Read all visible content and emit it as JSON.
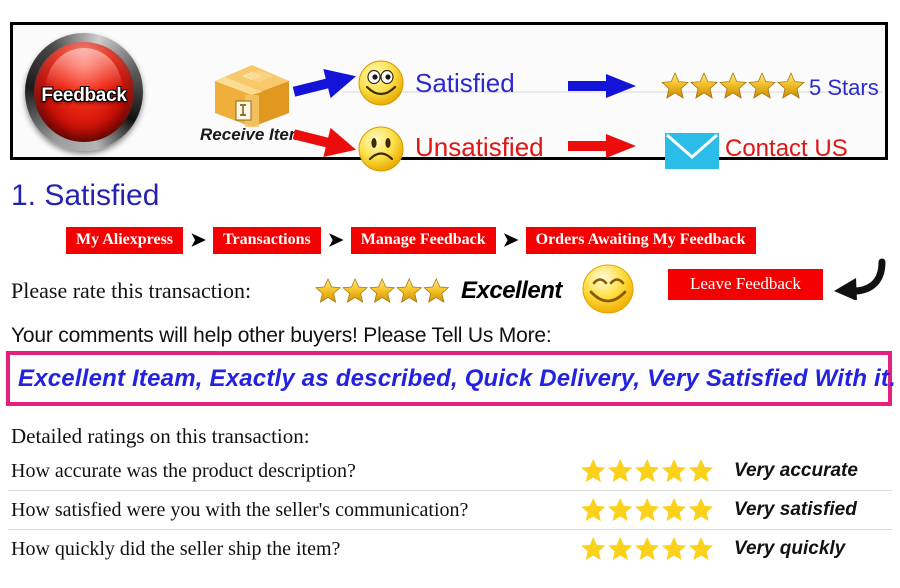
{
  "banner": {
    "feedback_button_label": "Feedback",
    "receive_item_label": "Receive Item",
    "satisfied_label": "Satisfied",
    "unsatisfied_label": "Unsatisfied",
    "five_stars_label": "5 Stars",
    "contact_us_label": "Contact US",
    "colors": {
      "satisfied_text": "#2a2ad0",
      "unsatisfied_text": "#e01515",
      "button_red": "#f22d18",
      "envelope_blue": "#29bde8",
      "star_gold": "#f0b21c"
    }
  },
  "section": {
    "title": "1. Satisfied",
    "title_color": "#2424ad"
  },
  "breadcrumb": {
    "separator": "➤",
    "items": [
      {
        "label": "My Aliexpress"
      },
      {
        "label": "Transactions"
      },
      {
        "label": "Manage Feedback"
      },
      {
        "label": "Orders Awaiting My Feedback"
      }
    ]
  },
  "rate_row": {
    "label": "Please rate this transaction:",
    "stars": 5,
    "rating_word": "Excellent",
    "leave_feedback_label": "Leave Feedback"
  },
  "comments": {
    "prompt": "Your comments will help other buyers! Please Tell Us More:",
    "review_text": "Excellent Iteam, Exactly as described, Quick Delivery, Very Satisfied With it.",
    "box_border_color": "#e5207f",
    "review_text_color": "#2222e0"
  },
  "detailed_ratings": {
    "title": "Detailed ratings on this transaction:",
    "star_color": "#fbd11a",
    "rows": [
      {
        "question": "How accurate was the product description?",
        "stars": 5,
        "answer": "Very accurate"
      },
      {
        "question": "How satisfied were you with the seller's communication?",
        "stars": 5,
        "answer": "Very satisfied"
      },
      {
        "question": "How quickly did the seller ship the item?",
        "stars": 5,
        "answer": "Very quickly"
      }
    ]
  }
}
